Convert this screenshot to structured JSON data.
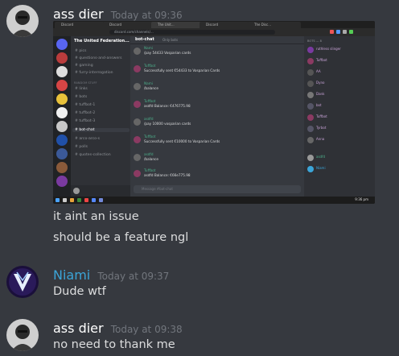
{
  "messages": [
    {
      "author": "ass dier",
      "timestamp": "Today at 09:36",
      "lines": [
        "it aint an issue",
        "should be a feature ngl"
      ]
    },
    {
      "author": "Niami",
      "timestamp": "Today at 09:37",
      "lines": [
        "Dude wtf"
      ]
    },
    {
      "author": "ass dier",
      "timestamp": "Today at 09:38",
      "lines": [
        "no need to thank me"
      ]
    }
  ],
  "colors": {
    "background": "#36393f",
    "author_default": "#ffffff",
    "author_niami": "#3ba5d8",
    "text": "#dcddde",
    "timestamp": "#72767d"
  },
  "screenshot": {
    "tabs": [
      "Discord",
      "Discord",
      "The Unit...",
      "Discord",
      "The Disc..."
    ],
    "url": "discord.com/channels/...",
    "server_name": "The United Federation...",
    "channels": [
      "pics",
      "questions-and-answers",
      "gaming",
      "furry-interrogation",
      "links",
      "bots",
      "tuffbot-1",
      "tuffbot-2",
      "tuffbot-3",
      "bot-chat",
      "arco-arco-s",
      "polls",
      "quotes-collection"
    ],
    "category": "RANDOM STUFF",
    "channel_title": "bot-chat",
    "channel_topic": "Only bots",
    "chat_lines": [
      {
        "name": "Nami",
        "text": "/pay 54433 Vosparian cards"
      },
      {
        "name": "Tuffbot",
        "text": "Successfully sent €54433 to Vosparian Cards"
      },
      {
        "name": "Nami",
        "text": "/balance"
      },
      {
        "name": "Tuffbot",
        "text": "asdfd Balance: €476775.98"
      },
      {
        "name": "asdfd",
        "text": "/pay 10000 vosparian cards"
      },
      {
        "name": "Tuffbot",
        "text": "Successfully sent €10000 to Vosparian Cards"
      },
      {
        "name": "asdfd",
        "text": "/balance"
      },
      {
        "name": "Tuffbot",
        "text": "asdfd Balance: €66e775.98"
      }
    ],
    "input_placeholder": "Message #bot-chat",
    "members_header": "BOTS — 8",
    "members": [
      "ruthless slinger",
      "Tuffbot",
      "AA",
      "Dyno",
      "Dank",
      "bot",
      "Tuffbot",
      "Tyrbot",
      "Anna",
      "asdfd",
      "Niami"
    ],
    "clock": "9:36 pm"
  }
}
